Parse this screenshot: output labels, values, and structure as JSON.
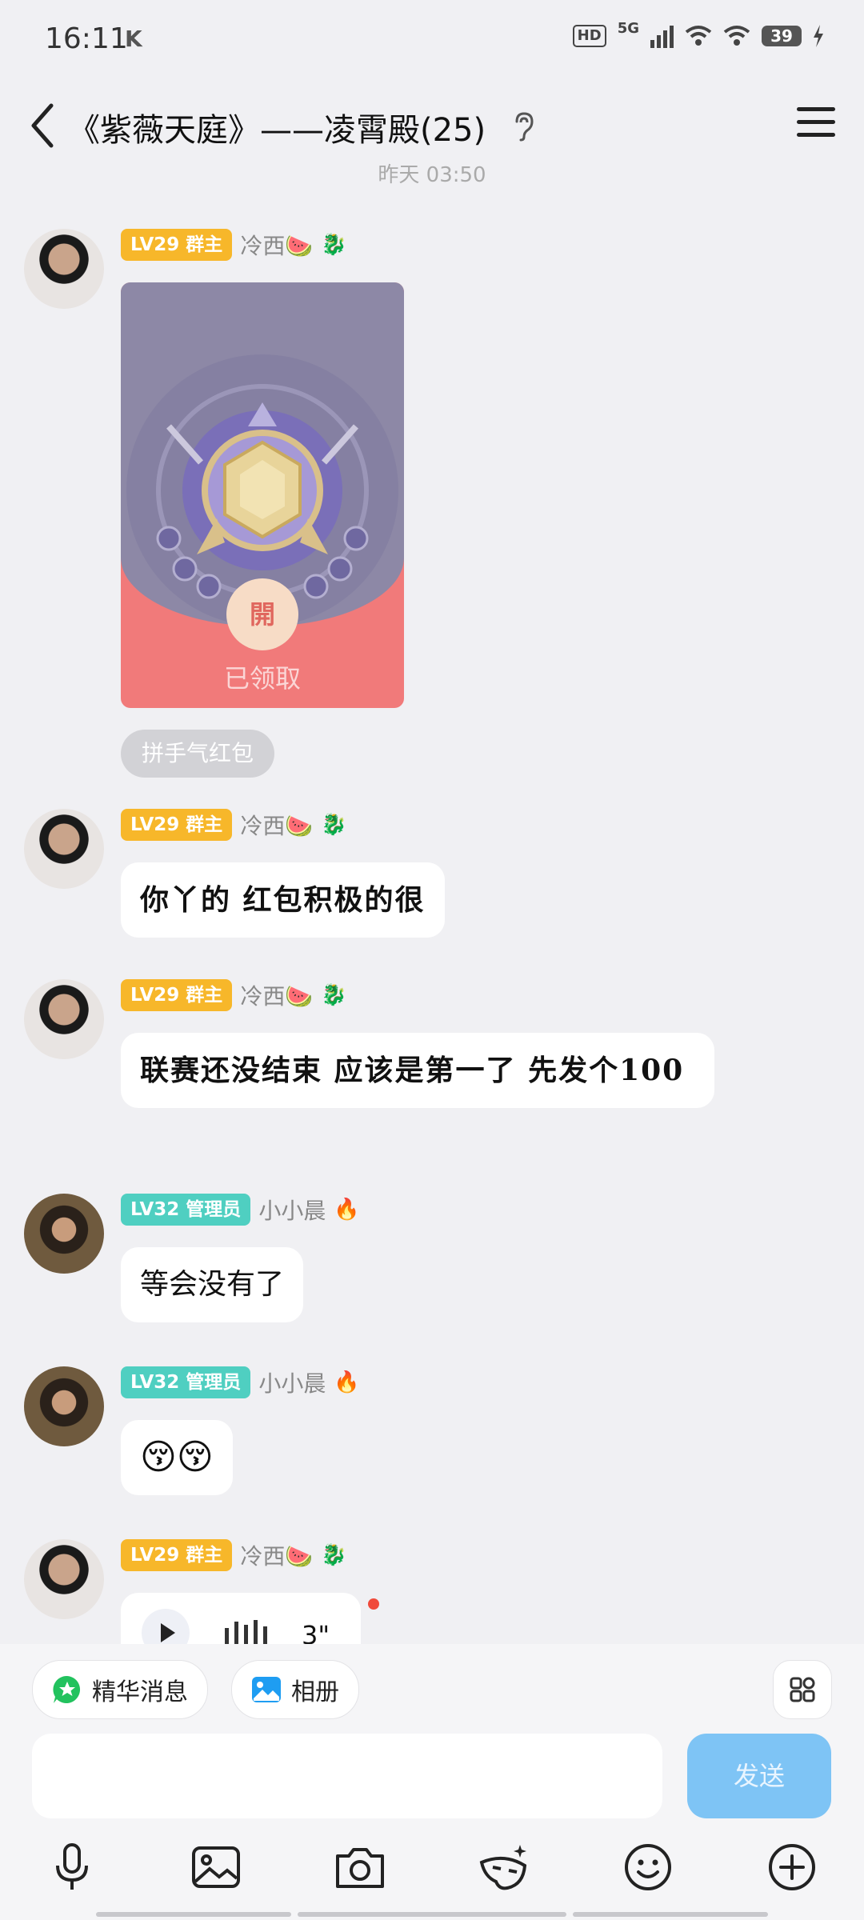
{
  "status": {
    "time": "16:11",
    "carrier_mark": "K",
    "hd": "HD",
    "network": "5G",
    "battery": "39"
  },
  "header": {
    "title": "《紫薇天庭》——凌霄殿(25)"
  },
  "timestamp": "昨天 03:50",
  "messages": [
    {
      "badge": "LV29 群主",
      "nick": "冷西🍉",
      "red_packet": {
        "open": "開",
        "status": "已领取"
      },
      "tag": "拼手气红包"
    },
    {
      "badge": "LV29 群主",
      "nick": "冷西🍉",
      "text": "你丫的 红包积极的很"
    },
    {
      "badge": "LV29 群主",
      "nick": "冷西🍉",
      "text": "联赛还没结束 应该是第一了 先发个100"
    },
    {
      "badge": "LV32 管理员",
      "nick": "小小晨",
      "text": "等会没有了"
    },
    {
      "badge": "LV32 管理员",
      "nick": "小小晨",
      "text": "😚😚"
    },
    {
      "badge": "LV29 群主",
      "nick": "冷西🍉",
      "voice": "3\""
    }
  ],
  "bottom": {
    "essence": "精华消息",
    "album": "相册",
    "send": "发送",
    "input_placeholder": ""
  },
  "colors": {
    "owner_badge": "#f7b72a",
    "admin_badge": "#4fcfc1",
    "send_button": "#7ec4f5",
    "red_packet": "#f17a7a"
  }
}
